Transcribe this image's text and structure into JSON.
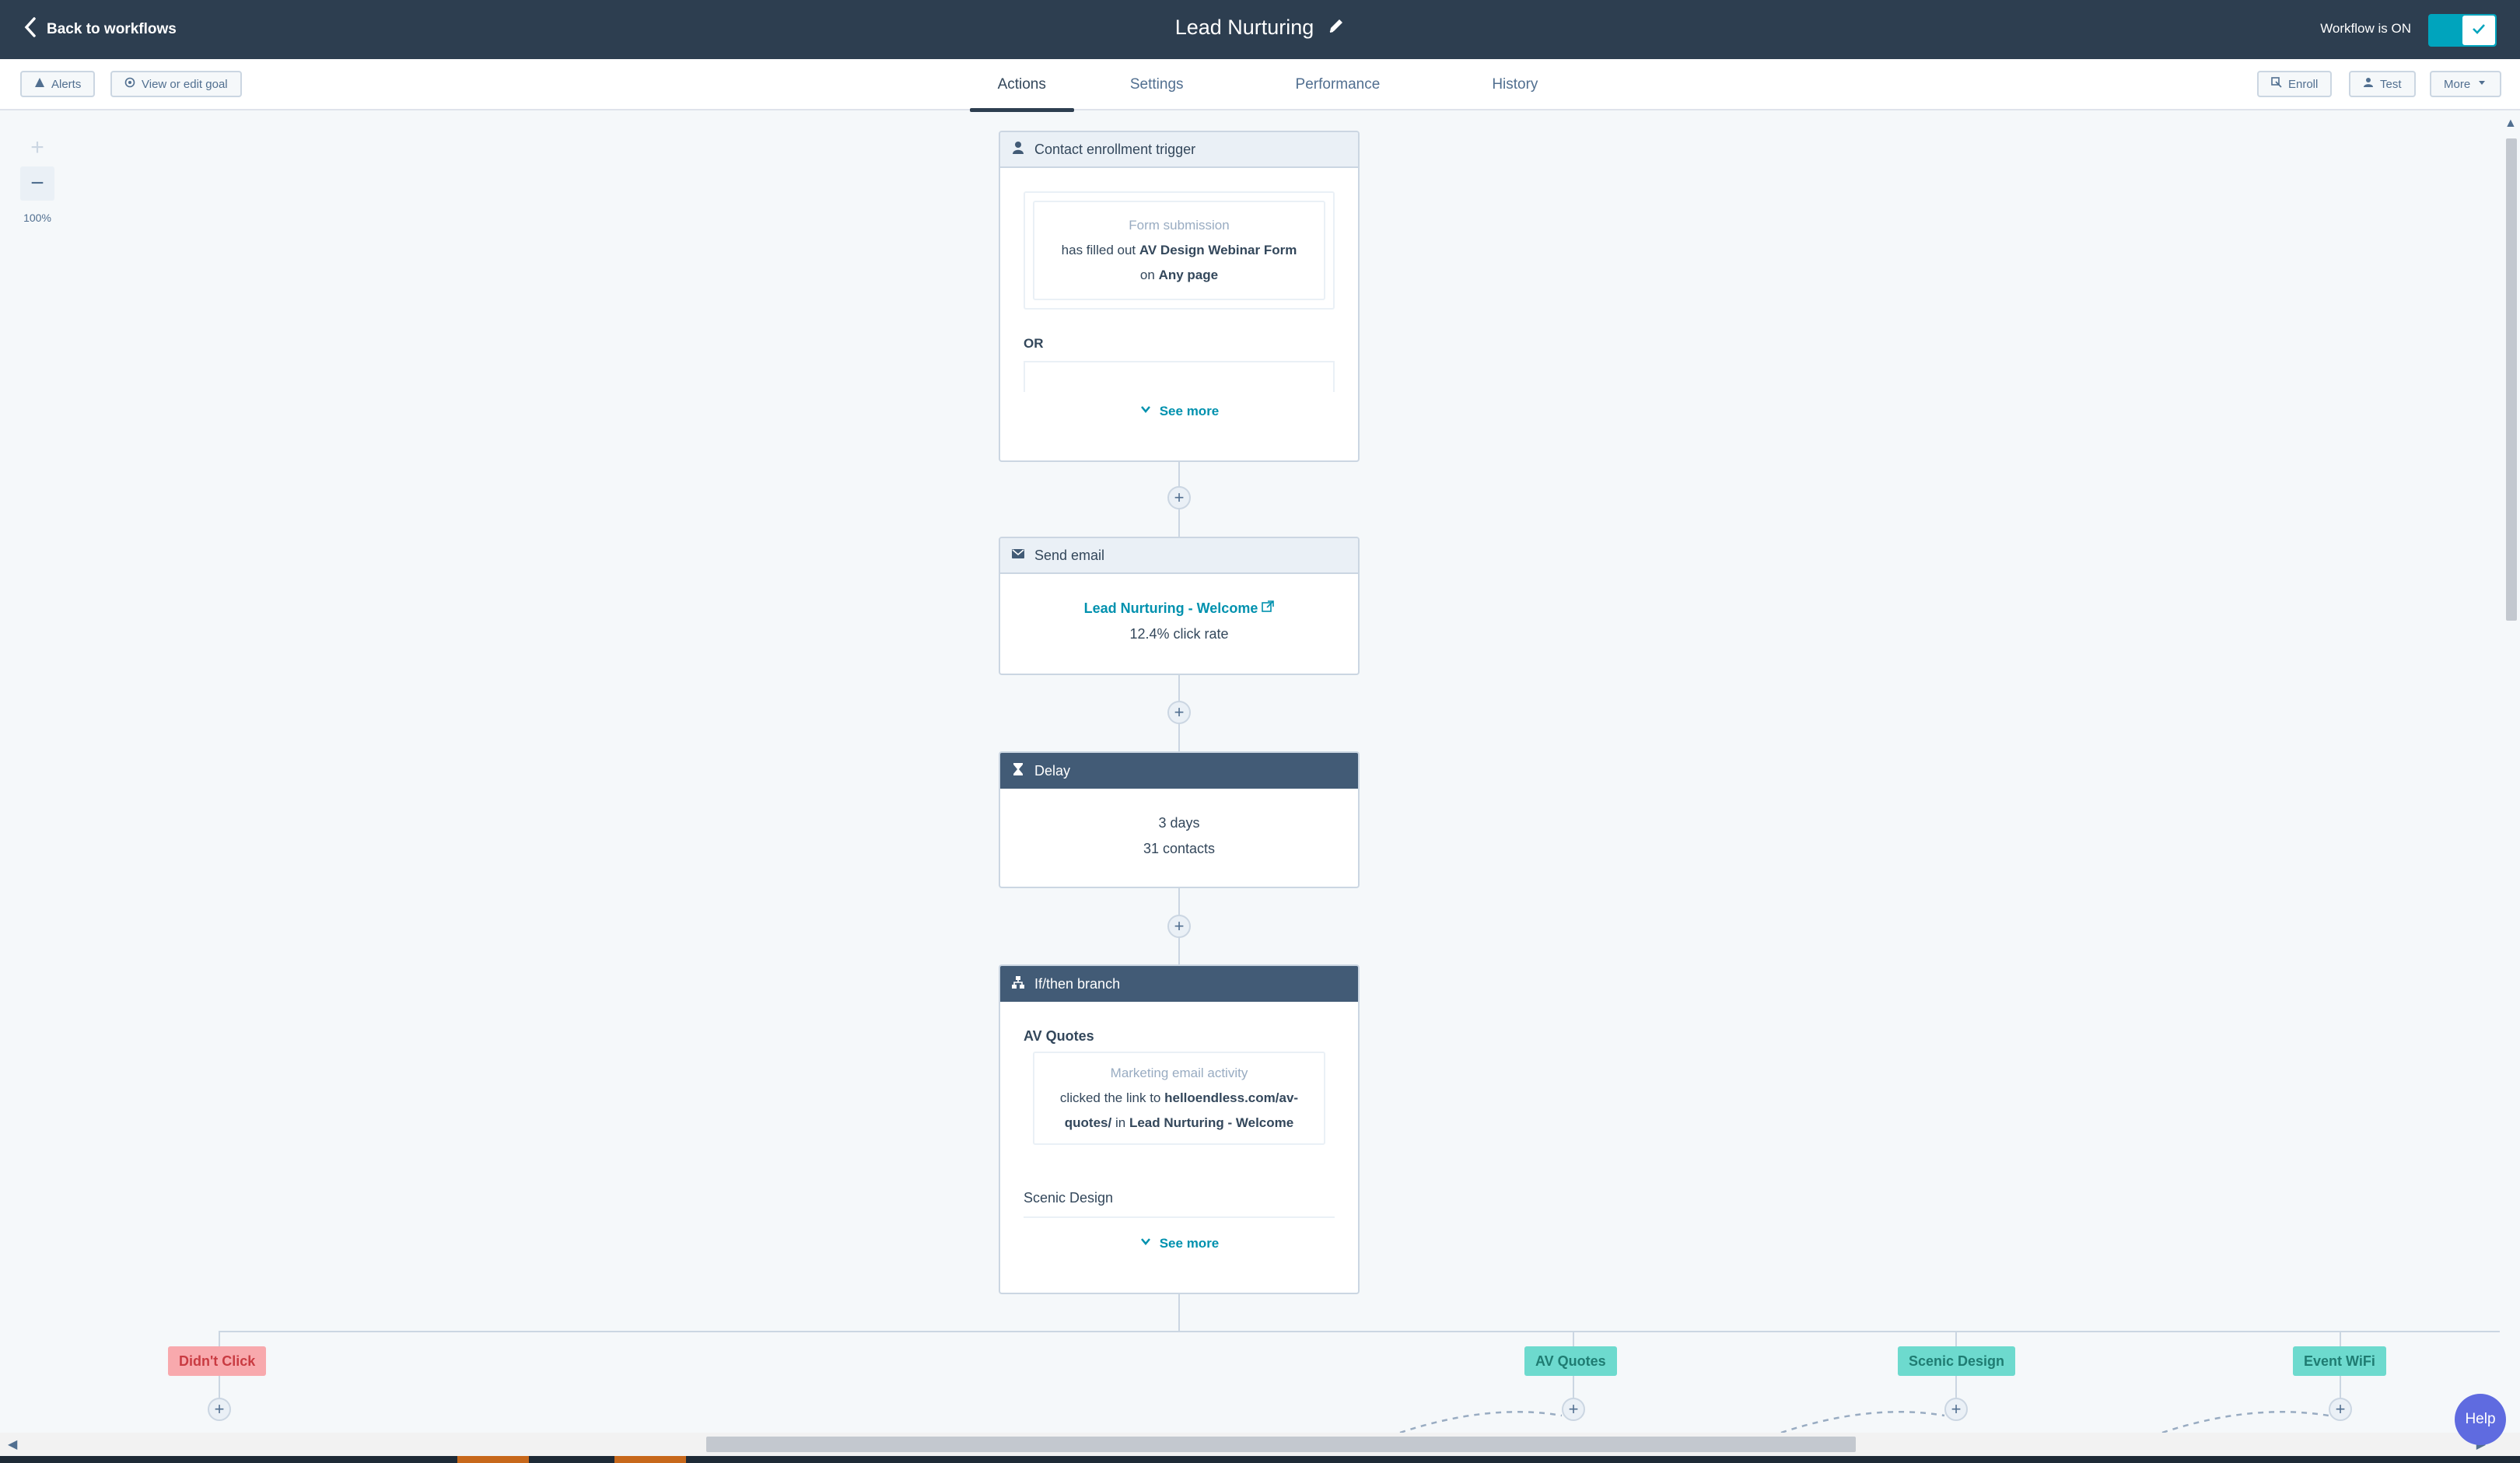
{
  "topbar": {
    "back_label": "Back to workflows",
    "title": "Lead Nurturing",
    "status_text": "Workflow is ON"
  },
  "subnav": {
    "alerts_label": "Alerts",
    "goal_label": "View or edit goal",
    "tabs": [
      {
        "label": "Actions",
        "active": true
      },
      {
        "label": "Settings",
        "active": false
      },
      {
        "label": "Performance",
        "active": false
      },
      {
        "label": "History",
        "active": false
      }
    ],
    "enroll_label": "Enroll",
    "test_label": "Test",
    "more_label": "More"
  },
  "zoom": {
    "plus": "+",
    "minus": "−",
    "level": "100%"
  },
  "trigger": {
    "header": "Contact enrollment trigger",
    "cond_type": "Form submission",
    "cond_prefix": "has filled out",
    "cond_form": "AV Design Webinar Form",
    "cond_on": "on",
    "cond_page": "Any page",
    "or_label": "OR",
    "see_more": "See more"
  },
  "email": {
    "header": "Send email",
    "email_name": "Lead Nurturing - Welcome",
    "click_rate": "12.4% click rate"
  },
  "delay": {
    "header": "Delay",
    "duration": "3 days",
    "contacts": "31 contacts"
  },
  "branch": {
    "header": "If/then branch",
    "branch1_name": "AV Quotes",
    "cond_type": "Marketing email activity",
    "cond_prefix": "clicked the link to",
    "cond_link_a": "helloendless.com/av-",
    "cond_link_b": "quotes/",
    "cond_in": "in",
    "cond_email": "Lead Nurturing - Welcome",
    "branch2_name": "Scenic Design",
    "see_more": "See more"
  },
  "branch_tags": [
    {
      "label": "Didn't Click",
      "color": "#f8a9ad"
    },
    {
      "label": "AV Quotes",
      "color": "#6ddace"
    },
    {
      "label": "Scenic Design",
      "color": "#6ddace"
    },
    {
      "label": "Event WiFi",
      "color": "#6ddace"
    }
  ],
  "help_label": "Help",
  "colors": {
    "nav_dark": "#2d3e50",
    "accent": "#00a4bd",
    "link": "#0091ae",
    "header_dark": "#425b76"
  }
}
